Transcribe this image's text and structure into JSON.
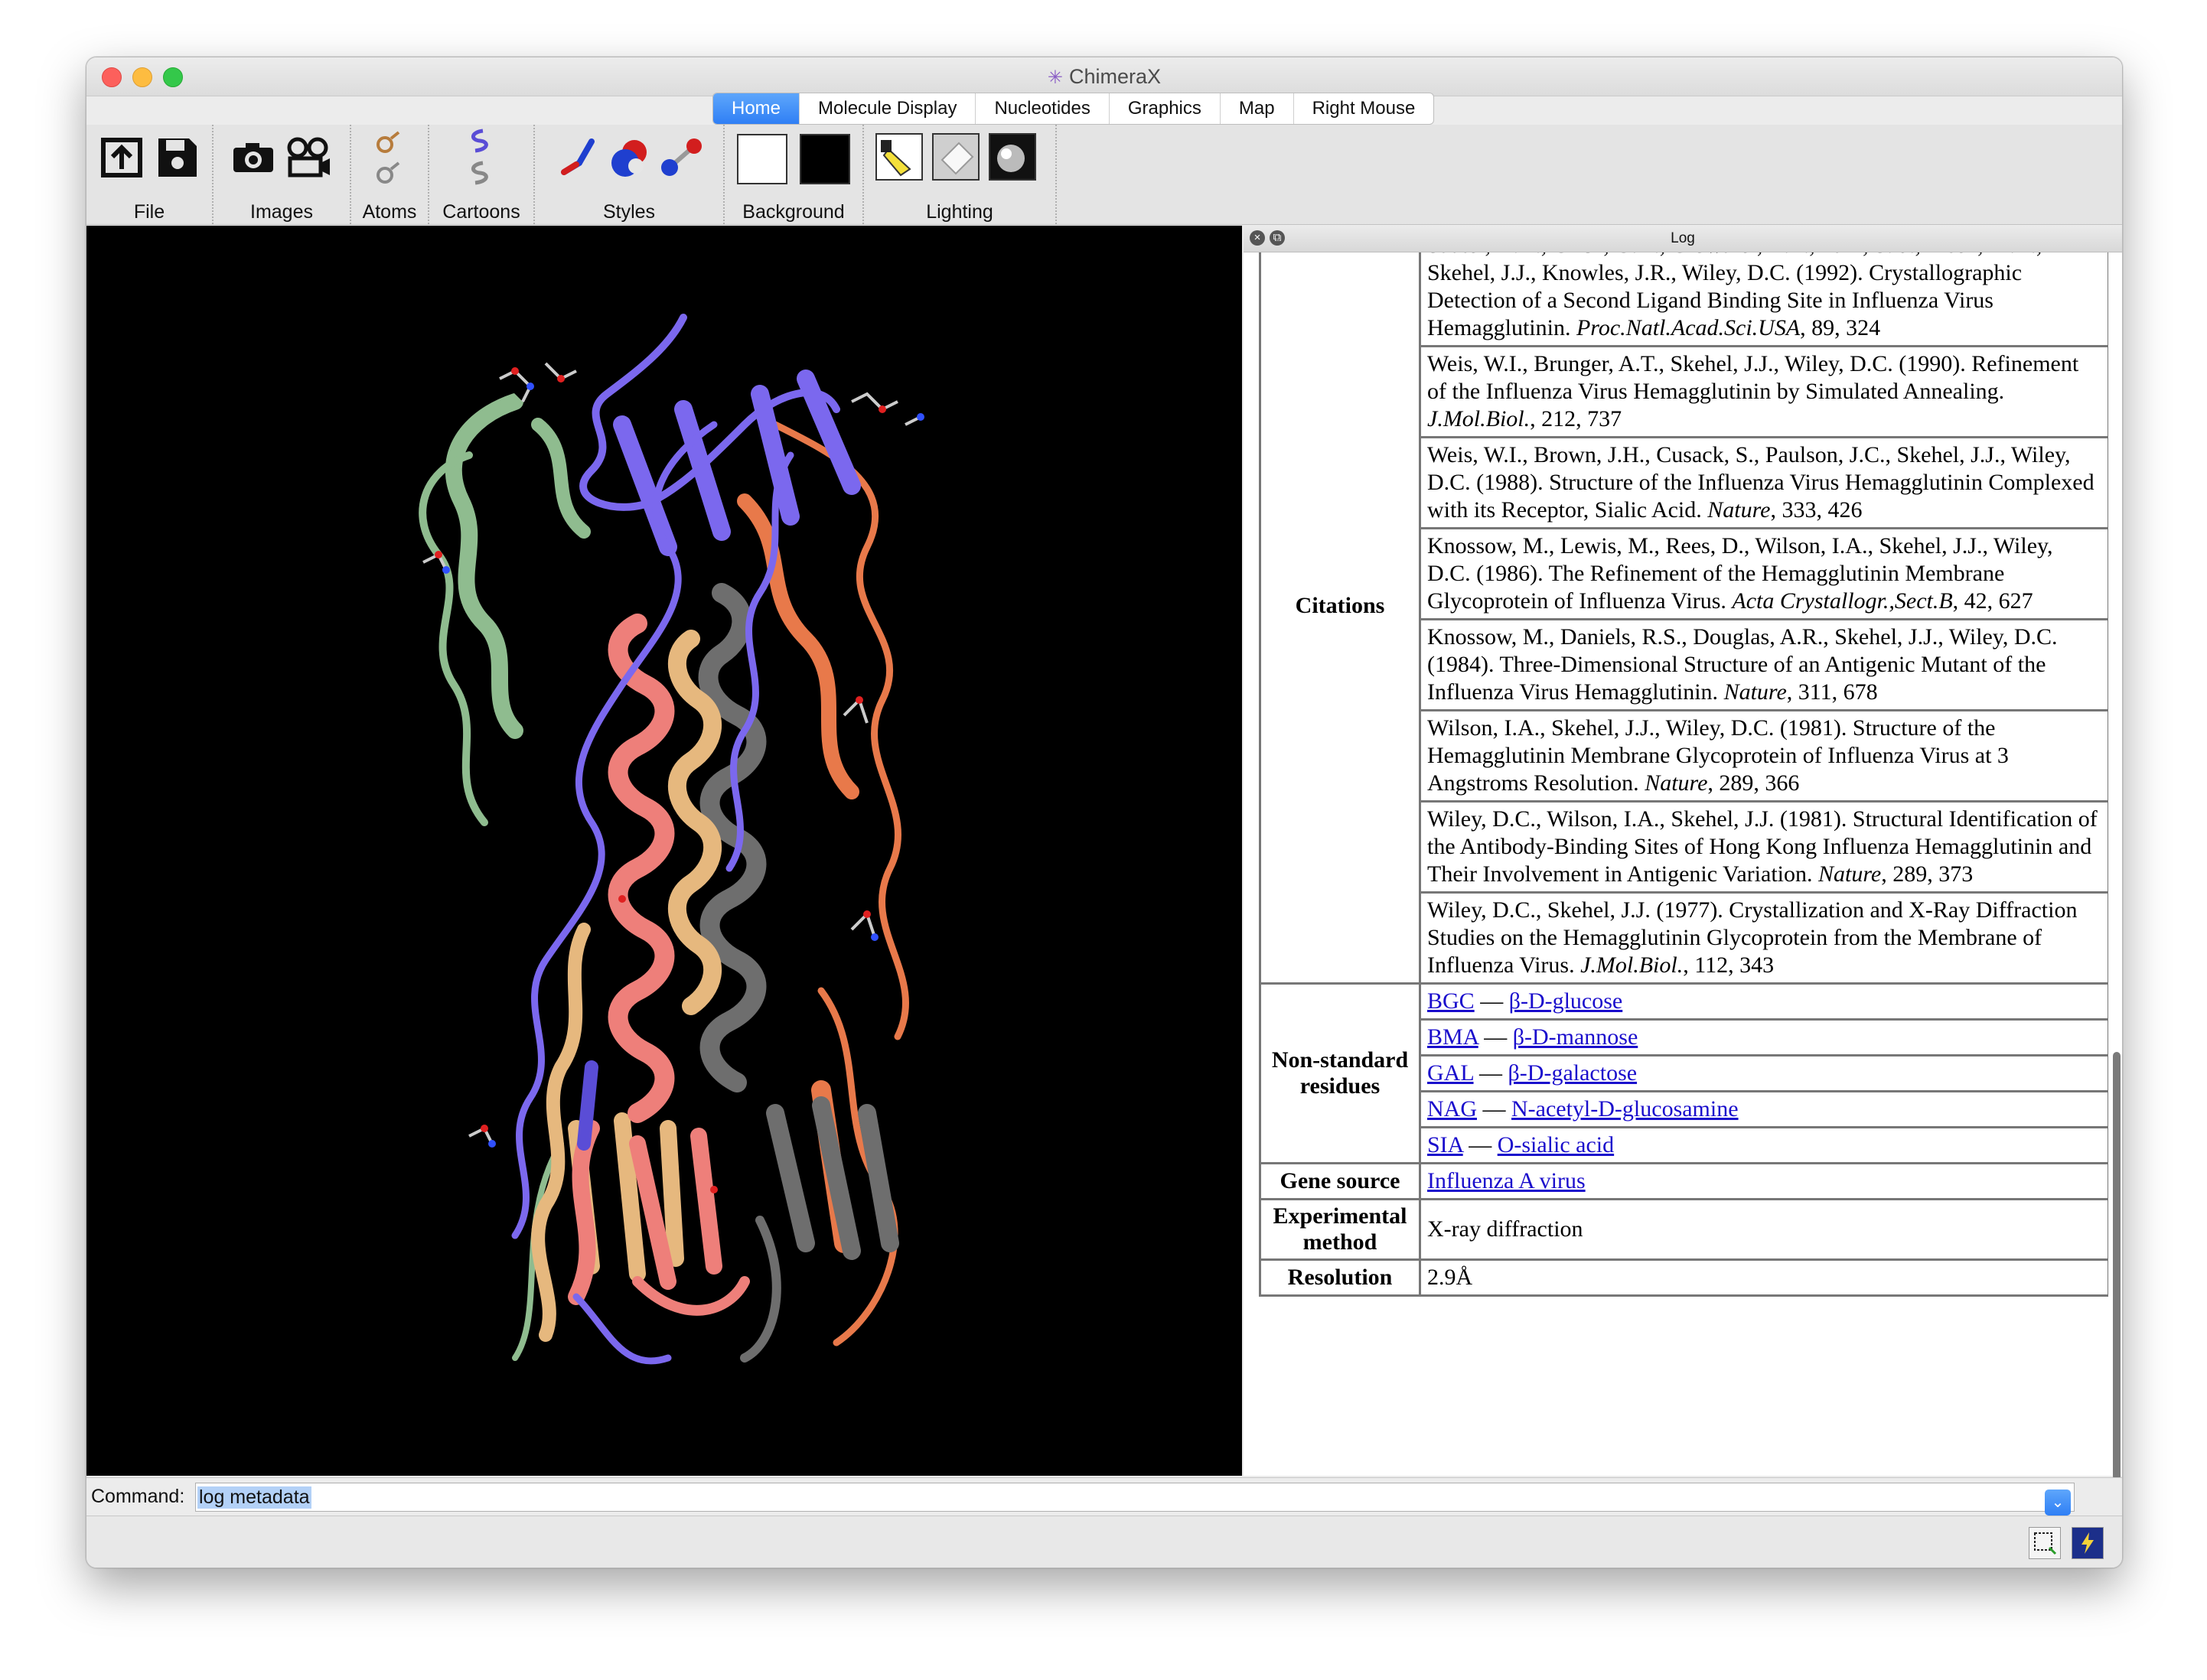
{
  "window": {
    "title": "ChimeraX"
  },
  "tabs": [
    "Home",
    "Molecule Display",
    "Nucleotides",
    "Graphics",
    "Map",
    "Right Mouse"
  ],
  "toolbar": {
    "groups": {
      "file": "File",
      "images": "Images",
      "atoms": "Atoms",
      "cartoons": "Cartoons",
      "styles": "Styles",
      "background": "Background",
      "lighting": "Lighting"
    }
  },
  "log": {
    "title": "Log",
    "citations_label": "Citations",
    "citations": [
      {
        "text": "Sauter, N.K., Glick, G.D., Crowther, R.L., Park, S.-J., Eisen, M.B., Skehel, J.J., Knowles, J.R., Wiley, D.C. (1992). Crystallographic Detection of a Second Ligand Binding Site in Influenza Virus Hemagglutinin.",
        "journal": "Proc.Natl.Acad.Sci.USA",
        "ref": ", 89, 324"
      },
      {
        "text": "Weis, W.I., Brunger, A.T., Skehel, J.J., Wiley, D.C. (1990). Refinement of the Influenza Virus Hemagglutinin by Simulated Annealing.",
        "journal": "J.Mol.Biol.",
        "ref": ", 212, 737"
      },
      {
        "text": "Weis, W.I., Brown, J.H., Cusack, S., Paulson, J.C., Skehel, J.J., Wiley, D.C. (1988). Structure of the Influenza Virus Hemagglutinin Complexed with its Receptor, Sialic Acid.",
        "journal": "Nature",
        "ref": ", 333, 426"
      },
      {
        "text": "Knossow, M., Lewis, M., Rees, D., Wilson, I.A., Skehel, J.J., Wiley, D.C. (1986). The Refinement of the Hemagglutinin Membrane Glycoprotein of Influenza Virus.",
        "journal": "Acta Crystallogr.,Sect.B",
        "ref": ", 42, 627"
      },
      {
        "text": "Knossow, M., Daniels, R.S., Douglas, A.R., Skehel, J.J., Wiley, D.C. (1984). Three-Dimensional Structure of an Antigenic Mutant of the Influenza Virus Hemagglutinin.",
        "journal": "Nature",
        "ref": ", 311, 678"
      },
      {
        "text": "Wilson, I.A., Skehel, J.J., Wiley, D.C. (1981). Structure of the Hemagglutinin Membrane Glycoprotein of Influenza Virus at 3 Angstroms Resolution.",
        "journal": "Nature",
        "ref": ", 289, 366"
      },
      {
        "text": "Wiley, D.C., Wilson, I.A., Skehel, J.J. (1981). Structural Identification of the Antibody-Binding Sites of Hong Kong Influenza Hemagglutinin and Their Involvement in Antigenic Variation.",
        "journal": "Nature",
        "ref": ", 289, 373"
      },
      {
        "text": "Wiley, D.C., Skehel, J.J. (1977). Crystallization and X-Ray Diffraction Studies on the Hemagglutinin Glycoprotein from the Membrane of Influenza Virus.",
        "journal": "J.Mol.Biol.",
        "ref": ", 112, 343"
      }
    ],
    "residues_label": "Non-standard residues",
    "residues": [
      {
        "code": "BGC",
        "sep": "—",
        "name": "β-D-glucose"
      },
      {
        "code": "BMA",
        "sep": "—",
        "name": "β-D-mannose"
      },
      {
        "code": "GAL",
        "sep": "—",
        "name": "β-D-galactose"
      },
      {
        "code": "NAG",
        "sep": "—",
        "name": "N-acetyl-D-glucosamine"
      },
      {
        "code": "SIA",
        "sep": "—",
        "name": "O-sialic acid"
      }
    ],
    "gene_source_label": "Gene source",
    "gene_source": "Influenza A virus",
    "method_label": "Experimental method",
    "method": "X-ray diffraction",
    "resolution_label": "Resolution",
    "resolution": "2.9Å"
  },
  "command": {
    "label": "Command:",
    "value": "log metadata"
  },
  "colors": {
    "chain_green": "#8fbc8f",
    "chain_purple": "#7b68ee",
    "chain_orange": "#e8794a",
    "chain_salmon": "#ee7f7a",
    "chain_tan": "#e6b87e",
    "chain_gray": "#6e6e6e",
    "tab_active": "#2f7ff5",
    "link": "#1a0dcc"
  },
  "icons": [
    "open-icon",
    "save-icon",
    "camera-icon",
    "movie-camera-icon",
    "atoms-show-icon",
    "atoms-hide-icon",
    "cartoon-show-icon",
    "cartoon-hide-icon",
    "stick-style-icon",
    "sphere-style-icon",
    "ball-stick-style-icon",
    "white-background-swatch",
    "black-background-swatch",
    "lighting-simple-icon",
    "lighting-soft-icon",
    "lighting-full-icon",
    "close-icon",
    "undock-icon",
    "selection-icon",
    "command-icon"
  ]
}
